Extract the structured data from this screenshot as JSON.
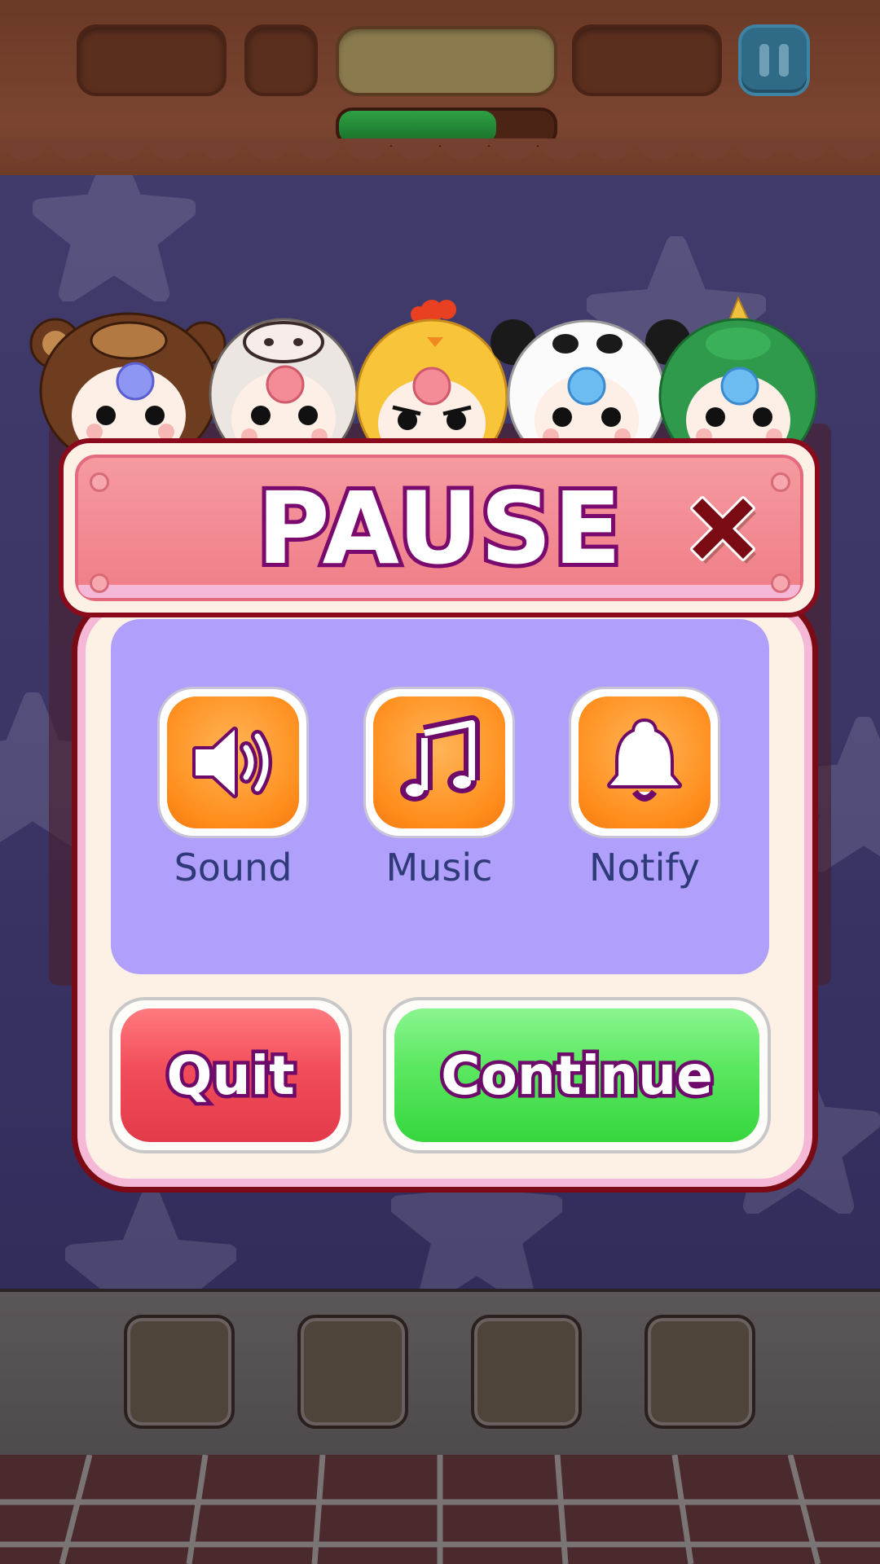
{
  "dialog": {
    "title": "PAUSE",
    "options": [
      {
        "label": "Sound",
        "icon": "speaker-icon"
      },
      {
        "label": "Music",
        "icon": "music-note-icon"
      },
      {
        "label": "Notify",
        "icon": "bell-icon"
      }
    ],
    "quit_label": "Quit",
    "continue_label": "Continue"
  },
  "hud": {
    "level_progress": 0.73
  },
  "characters": [
    "monkey-costume",
    "cow-costume",
    "chicken-costume",
    "panda-costume",
    "dinosaur-costume"
  ],
  "colors": {
    "accent_orange": "#ff8f1e",
    "quit_red": "#f24d5a",
    "continue_green": "#4fe056",
    "content_purple": "#b1a0fb",
    "outline_purple": "#7a0a6e"
  }
}
